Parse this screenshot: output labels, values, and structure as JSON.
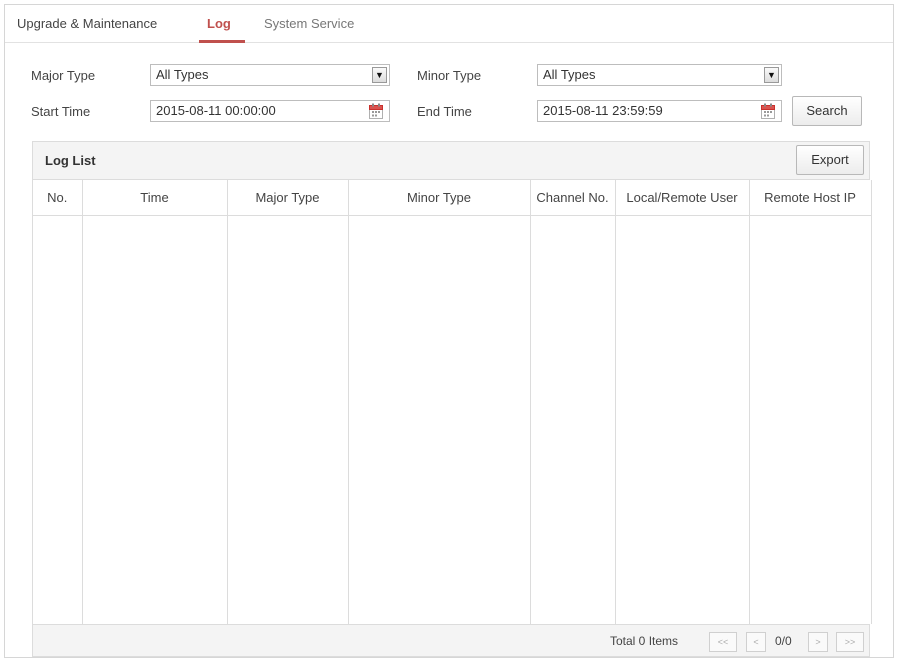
{
  "tabs": [
    {
      "label": "Upgrade & Maintenance"
    },
    {
      "label": "Log"
    },
    {
      "label": "System Service"
    }
  ],
  "active_tab": "Log",
  "filters": {
    "major_type": {
      "label": "Major Type",
      "value": "All Types"
    },
    "minor_type": {
      "label": "Minor Type",
      "value": "All Types"
    },
    "start_time": {
      "label": "Start Time",
      "value": "2015-08-11 00:00:00"
    },
    "end_time": {
      "label": "End Time",
      "value": "2015-08-11 23:59:59"
    },
    "search_label": "Search"
  },
  "log_list": {
    "title": "Log List",
    "export_label": "Export",
    "columns": [
      "No.",
      "Time",
      "Major Type",
      "Minor Type",
      "Channel No.",
      "Local/Remote User",
      "Remote Host IP"
    ],
    "rows": []
  },
  "pagination": {
    "total": "Total 0 Items",
    "first": "<<",
    "prev": "<",
    "info": "0/0",
    "next": ">",
    "last": ">>"
  },
  "colors": {
    "accent": "#c0504d",
    "border": "#dcdcdc",
    "panel_bg": "#f4f4f4"
  },
  "icons": [
    "chevron-down-icon",
    "calendar-icon"
  ]
}
